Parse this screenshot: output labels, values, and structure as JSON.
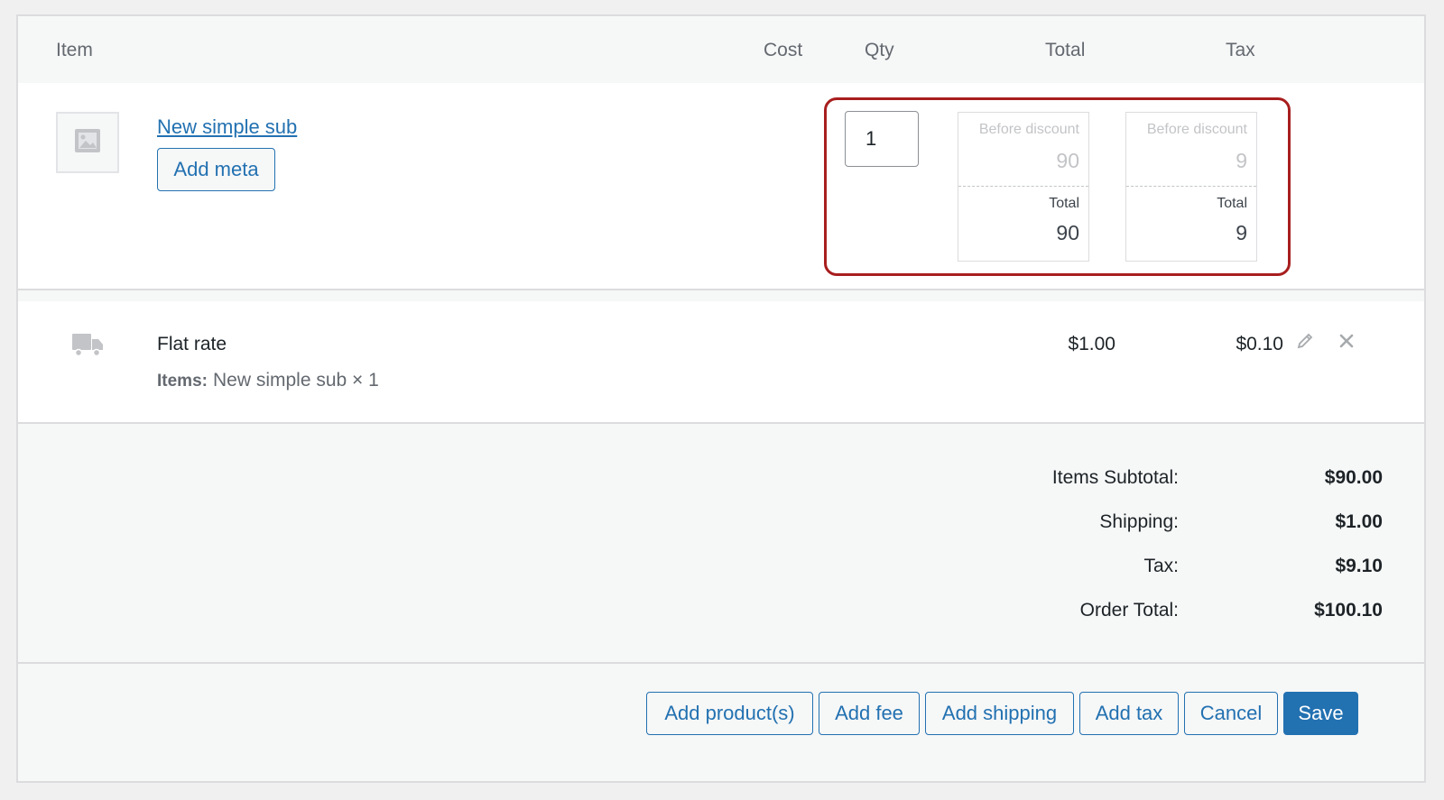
{
  "header": {
    "item": "Item",
    "cost": "Cost",
    "qty": "Qty",
    "total": "Total",
    "tax": "Tax"
  },
  "line_item": {
    "name": "New simple sub",
    "add_meta_label": "Add meta",
    "qty": "1",
    "total_box": {
      "before_label": "Before discount",
      "before_value": "90",
      "total_label": "Total",
      "total_value": "90"
    },
    "tax_box": {
      "before_label": "Before discount",
      "before_value": "9",
      "total_label": "Total",
      "total_value": "9"
    }
  },
  "shipping": {
    "name": "Flat rate",
    "items_label": "Items:",
    "items_value": "New simple sub × 1",
    "total": "$1.00",
    "tax": "$0.10"
  },
  "totals": {
    "subtotal_label": "Items Subtotal:",
    "subtotal_value": "$90.00",
    "shipping_label": "Shipping:",
    "shipping_value": "$1.00",
    "tax_label": "Tax:",
    "tax_value": "$9.10",
    "order_total_label": "Order Total:",
    "order_total_value": "$100.10"
  },
  "actions": {
    "add_products": "Add product(s)",
    "add_fee": "Add fee",
    "add_shipping": "Add shipping",
    "add_tax": "Add tax",
    "cancel": "Cancel",
    "save": "Save"
  },
  "colors": {
    "accent": "#2271b1",
    "highlight": "#a81e1e"
  },
  "icons": {
    "thumbnail": "image-placeholder-icon",
    "shipping": "truck-icon",
    "edit": "pencil-icon",
    "delete": "close-icon"
  }
}
